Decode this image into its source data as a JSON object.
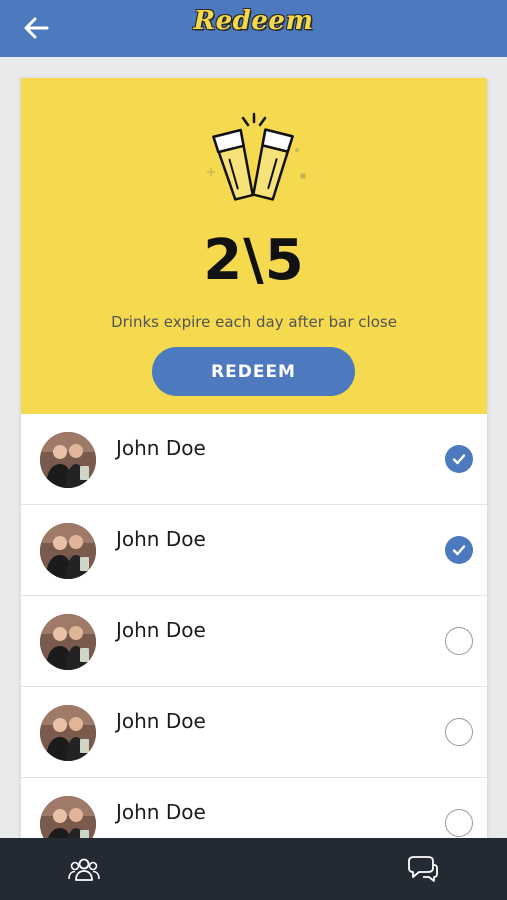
{
  "header": {
    "title": "Redeem",
    "back_icon": "arrow-left-icon"
  },
  "hero": {
    "icon": "cheers-beer-glasses-icon",
    "count_text": "2\\5",
    "redeemed": 2,
    "total": 5,
    "note": "Drinks expire each day after bar close",
    "redeem_label": "REDEEM"
  },
  "drinks": [
    {
      "name": "John Doe",
      "checked": true
    },
    {
      "name": "John Doe",
      "checked": true
    },
    {
      "name": "John Doe",
      "checked": false
    },
    {
      "name": "John Doe",
      "checked": false
    },
    {
      "name": "John Doe",
      "checked": false
    }
  ],
  "bottom_nav": {
    "left_icon": "friends-group-icon",
    "right_icon": "chat-bubbles-icon"
  },
  "colors": {
    "header_blue": "#4d79bf",
    "hero_yellow": "#f5d94f",
    "bottom_bar": "#232a33",
    "title_yellow": "#f6d94b"
  }
}
